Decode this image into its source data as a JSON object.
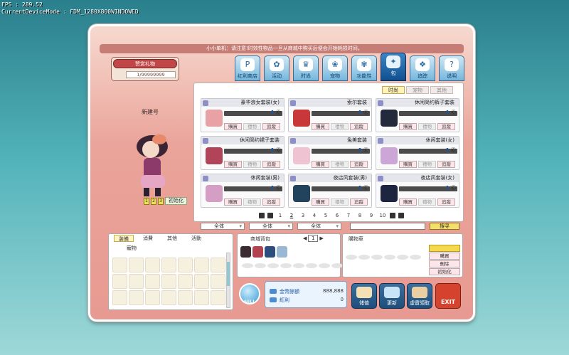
{
  "debug": {
    "fps": "FPS : 289.52",
    "mode": "CurrentDeviceMode : FDM_1280X800WINDOWED"
  },
  "notice": "小小单机：请注意!时效性物品一旦从商城中购买后便会开始耗损时间。",
  "gift": {
    "button": "赞赏礼物",
    "count": "1/99999999"
  },
  "character": {
    "name": "新建号",
    "reset": "初始化",
    "toggles": [
      "1",
      "2",
      "3"
    ]
  },
  "tabs": [
    {
      "label": "红利商店",
      "icon": "P"
    },
    {
      "label": "活动",
      "icon": "✿"
    },
    {
      "label": "时尚",
      "icon": "♛"
    },
    {
      "label": "宠物",
      "icon": "❀"
    },
    {
      "label": "功能性",
      "icon": "✾"
    },
    {
      "label": "包",
      "icon": "✦"
    },
    {
      "label": "追踪",
      "icon": "❖"
    },
    {
      "label": "说明",
      "icon": "?"
    }
  ],
  "subtabs": [
    "时尚",
    "宠物",
    "其他"
  ],
  "items": [
    {
      "name": "豪华浪女套装(女)",
      "price": "1",
      "thumb": "#e8a2a6"
    },
    {
      "name": "索尔套装",
      "price": "1",
      "thumb": "#c8383a"
    },
    {
      "name": "休闲简约裤子套装",
      "price": "1",
      "thumb": "#222a3c"
    },
    {
      "name": "休闲简约裙子套装",
      "price": "1",
      "thumb": "#b14458"
    },
    {
      "name": "兔美套装",
      "price": "1",
      "thumb": "#efc3d2"
    },
    {
      "name": "休闲套装(女)",
      "price": "1",
      "thumb": "#cda6d8"
    },
    {
      "name": "休闲套装(男)",
      "price": "1",
      "thumb": "#d59ec5"
    },
    {
      "name": "夜店风套装(男)",
      "price": "1",
      "thumb": "#23435c"
    },
    {
      "name": "夜店风套装(女)",
      "price": "1",
      "thumb": "#1c2440"
    }
  ],
  "item_buttons": {
    "buy": "購買",
    "gift": "禮物",
    "track": "追蹤"
  },
  "pages": [
    "1",
    "2",
    "3",
    "4",
    "5",
    "6",
    "7",
    "8",
    "9",
    "10"
  ],
  "current_page": "2",
  "filters": [
    "全体",
    "全体",
    "全体"
  ],
  "search_button": "搜寻",
  "inventory": {
    "tabs": [
      "装備",
      "消費",
      "其他",
      "活動"
    ],
    "sub": "寵物"
  },
  "bag": {
    "title": "商城背包",
    "page": "1"
  },
  "cart": {
    "title": "購物車",
    "buttons": [
      "購買",
      "刪除",
      "初始化"
    ]
  },
  "sell": "SELL",
  "money": [
    {
      "label": "金幣餘額",
      "value": "888,888"
    },
    {
      "label": "紅利",
      "value": "0"
    }
  ],
  "actions": [
    {
      "label": "储值"
    },
    {
      "label": "更新"
    },
    {
      "label": "虛寶領取"
    }
  ],
  "exit": "EXIT"
}
